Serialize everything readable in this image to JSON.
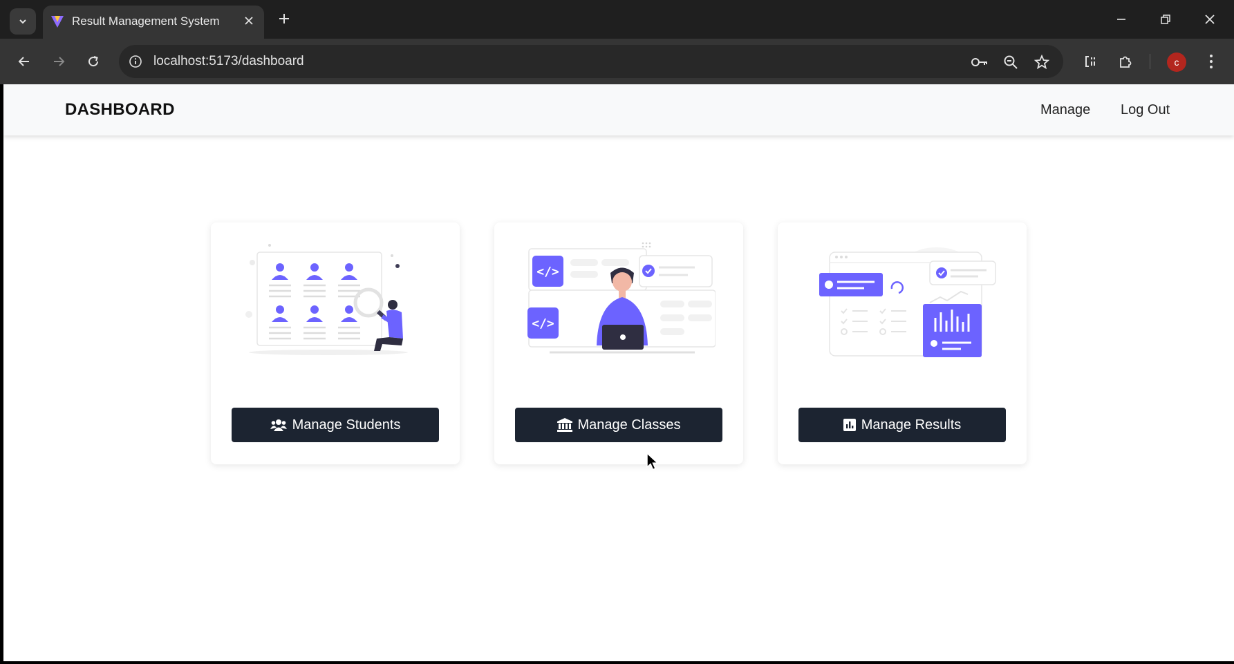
{
  "browser": {
    "tab_title": "Result Management System",
    "url": "localhost:5173/dashboard",
    "profile_initial": "c"
  },
  "navbar": {
    "brand": "DASHBOARD",
    "links": [
      "Manage",
      "Log Out"
    ]
  },
  "cards": [
    {
      "button_label": "Manage Students",
      "icon": "users-icon",
      "illustration": "student-search-illustration"
    },
    {
      "button_label": "Manage Classes",
      "icon": "institution-icon",
      "illustration": "developer-laptop-illustration"
    },
    {
      "button_label": "Manage Results",
      "icon": "bar-chart-icon",
      "illustration": "results-dashboard-illustration"
    }
  ],
  "colors": {
    "accent": "#6c63ff",
    "button_bg": "#1c2431",
    "navbar_bg": "#f8f9fa",
    "chrome_dark": "#1f1f1f",
    "chrome_toolbar": "#353535"
  }
}
